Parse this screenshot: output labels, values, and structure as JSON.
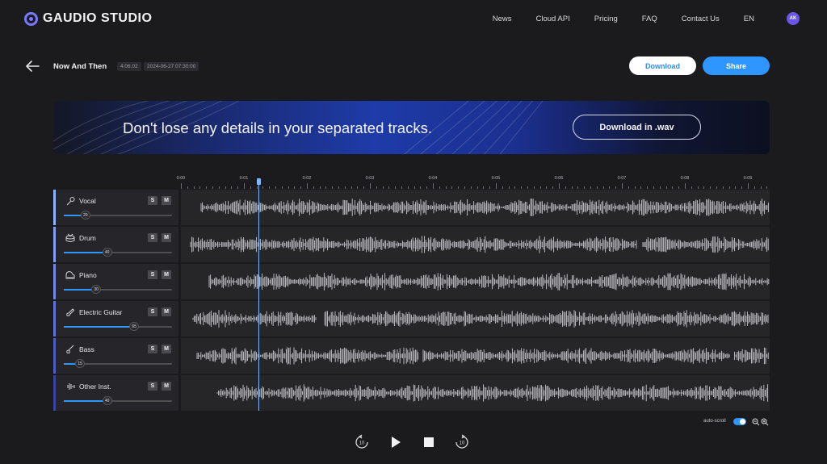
{
  "brand": {
    "name": "GAUDIO STUDIO"
  },
  "nav": {
    "items": [
      "News",
      "Cloud API",
      "Pricing",
      "FAQ",
      "Contact Us",
      "EN"
    ],
    "avatar": "AK"
  },
  "project": {
    "title": "Now And Then",
    "duration": "4:06.02",
    "created": "2024-06-27 07:30:00"
  },
  "actions": {
    "download": "Download",
    "share": "Share"
  },
  "banner": {
    "text": "Don't lose any details in your separated tracks.",
    "button": "Download in .wav"
  },
  "timeline": {
    "ticks": [
      "0:00",
      "0:01",
      "0:02",
      "0:03",
      "0:04",
      "0:05",
      "0:06",
      "0:07",
      "0:08",
      "0:09"
    ],
    "playhead": "0:01.25"
  },
  "tracks": [
    {
      "name": "Vocal",
      "volume": 20,
      "icon": "microphone-icon",
      "accent": "#8fb2ff",
      "solo": "S",
      "mute": "M"
    },
    {
      "name": "Drum",
      "volume": 40,
      "icon": "drum-icon",
      "accent": "#7f9ef4",
      "solo": "S",
      "mute": "M"
    },
    {
      "name": "Piano",
      "volume": 30,
      "icon": "piano-icon",
      "accent": "#7289e8",
      "solo": "S",
      "mute": "M"
    },
    {
      "name": "Electric Guitar",
      "volume": 65,
      "icon": "electric-guitar-icon",
      "accent": "#5f73d8",
      "solo": "S",
      "mute": "M"
    },
    {
      "name": "Bass",
      "volume": 15,
      "icon": "bass-guitar-icon",
      "accent": "#4b5cc4",
      "solo": "S",
      "mute": "M"
    },
    {
      "name": "Other Inst.",
      "volume": 40,
      "icon": "waveform-icon",
      "accent": "#39449e",
      "solo": "S",
      "mute": "M"
    }
  ],
  "footer": {
    "autoscroll_label": "auto-scroll",
    "autoscroll_on": true
  }
}
